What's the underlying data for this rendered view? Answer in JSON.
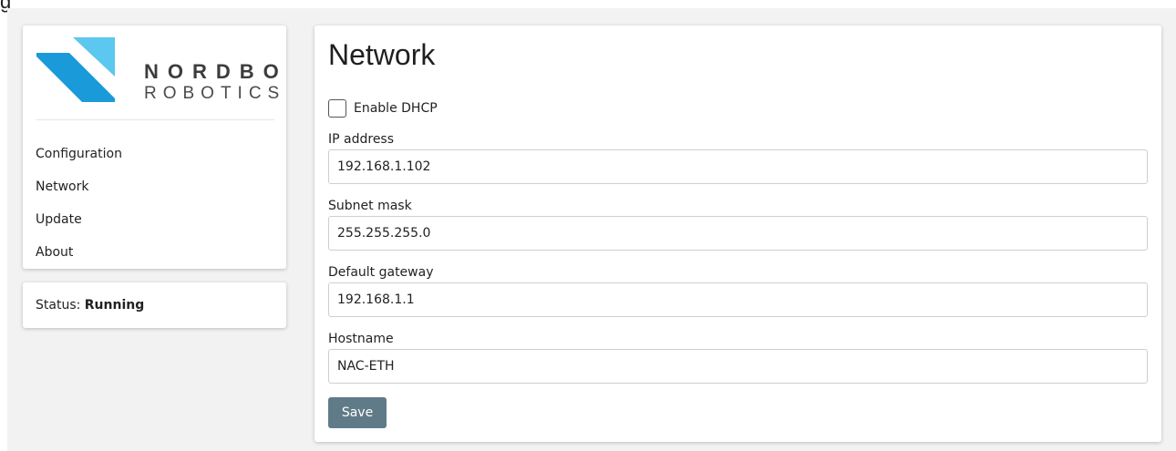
{
  "page_fragment": "g",
  "brand": {
    "name_line1": "NORDBO",
    "name_line2": "ROBOTICS",
    "colors": {
      "logo_dark_blue": "#1a9ad8",
      "logo_light_blue": "#5cc7ef",
      "text": "#3c3c3c"
    }
  },
  "sidebar": {
    "items": [
      {
        "label": "Configuration"
      },
      {
        "label": "Network"
      },
      {
        "label": "Update"
      },
      {
        "label": "About"
      }
    ]
  },
  "status": {
    "label": "Status:",
    "value": "Running"
  },
  "network": {
    "title": "Network",
    "dhcp": {
      "label": "Enable DHCP",
      "checked": false
    },
    "fields": {
      "ip_address": {
        "label": "IP address",
        "value": "192.168.1.102"
      },
      "subnet_mask": {
        "label": "Subnet mask",
        "value": "255.255.255.0"
      },
      "default_gateway": {
        "label": "Default gateway",
        "value": "192.168.1.1"
      },
      "hostname": {
        "label": "Hostname",
        "value": "NAC-ETH"
      }
    },
    "save_label": "Save"
  },
  "colors": {
    "save_button": "#5f7b88",
    "background": "#f2f2f2"
  }
}
